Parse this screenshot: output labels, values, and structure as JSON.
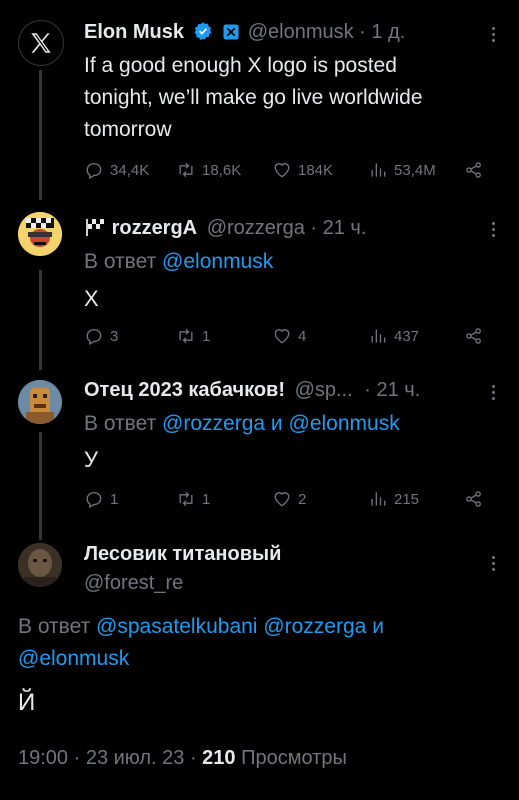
{
  "tweet1": {
    "name": "Elon Musk",
    "handle": "@elonmusk",
    "time": "· 1 д.",
    "text_lines": [
      "If a good enough X logo is posted",
      "tonight, we’ll make go live worldwide",
      "tomorrow"
    ],
    "replies": "34,4K",
    "retweets": "18,6K",
    "likes": "184K",
    "views": "53,4M"
  },
  "tweet2": {
    "name": "rozzergA",
    "handle": "@rozzerga",
    "time": "· 21 ч.",
    "reply_prefix": "В ответ",
    "reply_to": "@elonmusk",
    "text": "X",
    "replies": "3",
    "retweets": "1",
    "likes": "4",
    "views": "437"
  },
  "tweet3": {
    "name": "Отец 2023 кабачков!",
    "handle": "@sp...",
    "time": "· 21 ч.",
    "reply_prefix": "В ответ",
    "reply_to_1": "@rozzerga",
    "conj": "и",
    "reply_to_2": "@elonmusk",
    "text": "У",
    "replies": "1",
    "retweets": "1",
    "likes": "2",
    "views": "215"
  },
  "tweet4": {
    "name": "Лесовик титановый",
    "handle": "@forest_re",
    "reply_prefix": "В ответ",
    "reply_to_1": "@spasatelkubani",
    "reply_to_2": "@rozzerga",
    "conj": "и",
    "reply_to_3": "@elonmusk",
    "text": "Й",
    "meta_time": "19:00 · 23 июл. 23 ·",
    "views_count": "210",
    "views_label": "Просмотры"
  },
  "colors": {
    "accent": "#1d9bf0",
    "muted": "#71767b",
    "background": "#000000"
  }
}
